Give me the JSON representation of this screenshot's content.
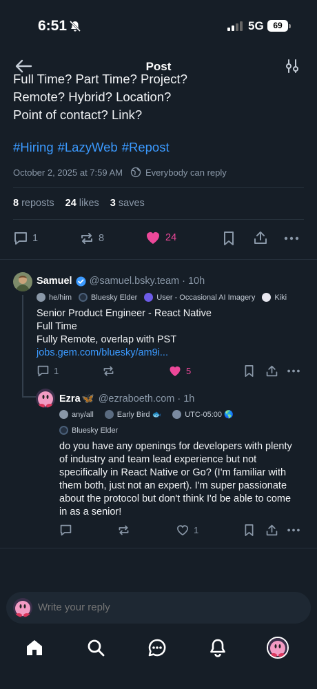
{
  "status": {
    "time": "6:51",
    "network": "5G",
    "battery": "69"
  },
  "header": {
    "title": "Post"
  },
  "post": {
    "cut_line": "Full Time? Part Time? Project?",
    "lines": [
      "Remote? Hybrid? Location?",
      "Point of contact? Link?"
    ],
    "hashtags": [
      "#Hiring",
      "#LazyWeb",
      "#Repost"
    ],
    "timestamp": "October 2, 2025 at 7:59 AM",
    "reply_setting": "Everybody can reply",
    "stats": {
      "reposts_count": "8",
      "reposts_label": "reposts",
      "likes_count": "24",
      "likes_label": "likes",
      "saves_count": "3",
      "saves_label": "saves"
    },
    "actions": {
      "replies": "1",
      "reposts": "8",
      "likes": "24"
    }
  },
  "reply1": {
    "name": "Samuel",
    "handle": "@samuel.bsky.team",
    "time": "· 10h",
    "badges": [
      "he/him",
      "Bluesky Elder",
      "User - Occasional AI Imagery",
      "Kiki"
    ],
    "text": [
      "Senior Product Engineer - React Native",
      "Full Time",
      "Fully Remote, overlap with PST"
    ],
    "link": "jobs.gem.com/bluesky/am9i...",
    "actions": {
      "replies": "1",
      "likes": "5"
    }
  },
  "reply2": {
    "name": "Ezra",
    "name_emoji": "🦋",
    "handle": "@ezraboeth.com",
    "time": "· 1h",
    "badges_row1": [
      "any/all",
      "Early Bird 🐟",
      "UTC-05:00 🌎"
    ],
    "badges_row2": [
      "Bluesky Elder"
    ],
    "text": [
      "do you have any openings for developers with plenty",
      "of industry and team lead experience but not",
      "specifically in React Native or Go? (I'm familiar with",
      "them both, just not an expert). I'm super passionate",
      "about the protocol but don't think I'd be able to come",
      "in as a senior!"
    ],
    "actions": {
      "likes": "1"
    }
  },
  "composer": {
    "placeholder": "Write your reply"
  },
  "colors": {
    "accent": "#3b9aff",
    "like": "#ec4899",
    "background": "#161e27",
    "muted": "#8a98a8"
  },
  "icons": {
    "tabs": [
      "home-icon",
      "search-icon",
      "chat-icon",
      "notifications-icon",
      "profile-avatar"
    ]
  }
}
